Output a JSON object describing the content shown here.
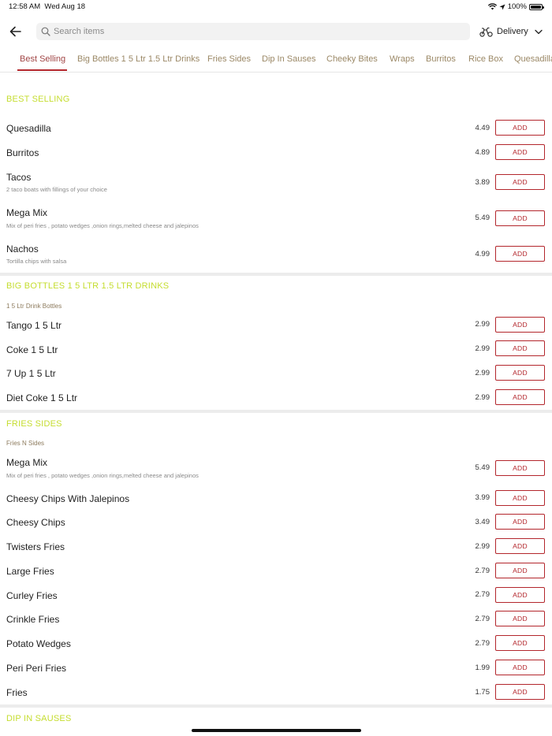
{
  "status_bar": {
    "time": "12:58 AM",
    "date": "Wed Aug 18",
    "battery": "100%"
  },
  "search": {
    "placeholder": "Search items",
    "value": ""
  },
  "delivery_mode": {
    "label": "Delivery"
  },
  "tabs": [
    {
      "label": "Best Selling",
      "active": true
    },
    {
      "label": "Big Bottles 1 5 Ltr 1.5 Ltr Drinks"
    },
    {
      "label": "Fries Sides"
    },
    {
      "label": "Dip In Sauses"
    },
    {
      "label": "Cheeky Bites"
    },
    {
      "label": "Wraps"
    },
    {
      "label": "Burritos"
    },
    {
      "label": "Rice Box"
    },
    {
      "label": "Quesadillas"
    }
  ],
  "add_label": "ADD",
  "sections": [
    {
      "title": "BEST SELLING",
      "subheading": "",
      "items": [
        {
          "name": "Quesadilla",
          "description": "",
          "price": "4.49"
        },
        {
          "name": "Burritos",
          "description": "",
          "price": "4.89"
        },
        {
          "name": "Tacos",
          "description": "2 taco boats with fillings of your choice",
          "price": "3.89"
        },
        {
          "name": "Mega Mix",
          "description": "Mix of peri fries , potato wedges ,onion rings,melted cheese and jalepinos",
          "price": "5.49"
        },
        {
          "name": "Nachos",
          "description": "Tortilla chips with salsa",
          "price": "4.99"
        }
      ]
    },
    {
      "title": "BIG BOTTLES 1 5 LTR 1.5 LTR DRINKS",
      "subheading": "1 5 Ltr Drink Bottles",
      "items": [
        {
          "name": "Tango 1 5 Ltr",
          "description": "",
          "price": "2.99"
        },
        {
          "name": "Coke 1 5 Ltr",
          "description": "",
          "price": "2.99"
        },
        {
          "name": "7 Up 1 5 Ltr",
          "description": "",
          "price": "2.99"
        },
        {
          "name": "Diet Coke 1 5 Ltr",
          "description": "",
          "price": "2.99"
        }
      ]
    },
    {
      "title": "FRIES SIDES",
      "subheading": "Fries N Sides",
      "items": [
        {
          "name": "Mega Mix",
          "description": "Mix of peri fries , potato wedges ,onion rings,melted cheese and jalepinos",
          "price": "5.49"
        },
        {
          "name": "Cheesy Chips With Jalepinos",
          "description": "",
          "price": "3.99"
        },
        {
          "name": "Cheesy Chips",
          "description": "",
          "price": "3.49"
        },
        {
          "name": "Twisters Fries",
          "description": "",
          "price": "2.99"
        },
        {
          "name": "Large Fries",
          "description": "",
          "price": "2.79"
        },
        {
          "name": "Curley Fries",
          "description": "",
          "price": "2.79"
        },
        {
          "name": "Crinkle Fries",
          "description": "",
          "price": "2.79"
        },
        {
          "name": "Potato Wedges",
          "description": "",
          "price": "2.79"
        },
        {
          "name": "Peri Peri Fries",
          "description": "",
          "price": "1.99"
        },
        {
          "name": "Fries",
          "description": "",
          "price": "1.75"
        }
      ]
    },
    {
      "title": "DIP IN SAUSES",
      "subheading": "",
      "items": []
    }
  ]
}
